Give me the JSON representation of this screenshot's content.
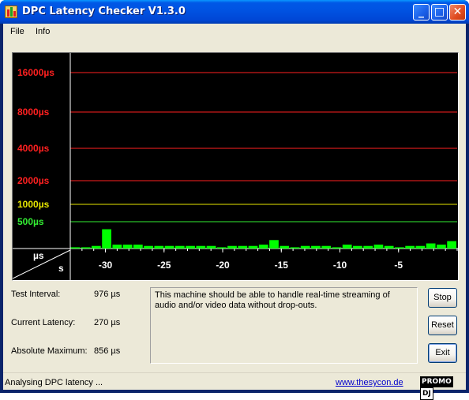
{
  "window": {
    "title": "DPC Latency Checker V1.3.0"
  },
  "titlebar_buttons": {
    "minimize": "_",
    "maximize": "□",
    "close": "✕"
  },
  "menu": [
    {
      "label": "File"
    },
    {
      "label": "Info"
    }
  ],
  "graph": {
    "y_levels": [
      {
        "label": "16000µs",
        "color": "#ff2020"
      },
      {
        "label": "8000µs",
        "color": "#ff2020"
      },
      {
        "label": "4000µs",
        "color": "#ff2020"
      },
      {
        "label": "2000µs",
        "color": "#ff2020"
      },
      {
        "label": "1000µs",
        "color": "#e6e600"
      },
      {
        "label": "500µs",
        "color": "#33ee33"
      }
    ],
    "axis_corner_top": "µs",
    "axis_corner_bottom": "s",
    "x_ticks": [
      "-30",
      "-25",
      "-20",
      "-15",
      "-10",
      "-5"
    ],
    "bar_color": "#00ff00",
    "bars": [
      180,
      180,
      190,
      370,
      200,
      200,
      200,
      190,
      190,
      190,
      190,
      190,
      190,
      190,
      180,
      190,
      190,
      190,
      200,
      240,
      190,
      180,
      190,
      190,
      190,
      180,
      200,
      190,
      190,
      200,
      190,
      180,
      190,
      190,
      210,
      200,
      230
    ]
  },
  "info": {
    "test_interval_label": "Test Interval:",
    "test_interval_value": "976 µs",
    "current_latency_label": "Current Latency:",
    "current_latency_value": "270 µs",
    "absolute_maximum_label": "Absolute Maximum:",
    "absolute_maximum_value": "856 µs"
  },
  "message": "This machine should be able to handle real-time streaming of audio and/or video data without drop-outs.",
  "buttons": {
    "stop": "Stop",
    "reset": "Reset",
    "exit": "Exit"
  },
  "status": {
    "text": "Analysing DPC latency ...",
    "link": "www.thesycon.de",
    "logo_left": "PROMO",
    "logo_right": "DJ"
  }
}
